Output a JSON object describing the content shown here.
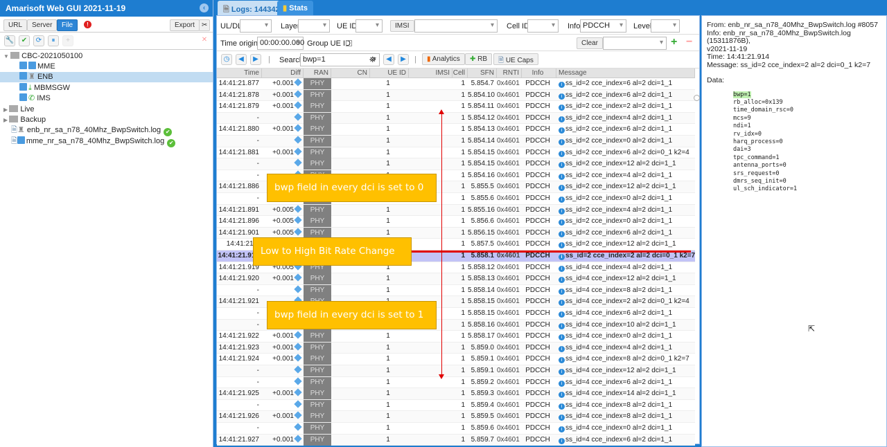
{
  "app": {
    "title": "Amarisoft Web GUI 2021-11-19"
  },
  "left": {
    "buttons": {
      "url": "URL",
      "server": "Server",
      "file": "File",
      "export": "Export"
    },
    "tree": [
      {
        "label": "CBC-2021050100",
        "type": "folder",
        "expanded": true
      },
      {
        "label": "MME",
        "type": "node"
      },
      {
        "label": "ENB",
        "type": "node",
        "selected": true
      },
      {
        "label": "MBMSGW",
        "type": "node"
      },
      {
        "label": "IMS",
        "type": "node"
      },
      {
        "label": "Live",
        "type": "folder"
      },
      {
        "label": "Backup",
        "type": "folder"
      },
      {
        "label": "enb_nr_sa_n78_40Mhz_BwpSwitch.log",
        "type": "log",
        "status": "ok"
      },
      {
        "label": "mme_nr_sa_n78_40Mhz_BwpSwitch.log",
        "type": "log",
        "status": "ok"
      }
    ]
  },
  "tabs": [
    {
      "label": "Logs: 144342",
      "active": true
    },
    {
      "label": "Stats"
    }
  ],
  "filters": {
    "uldl_label": "UL/DL",
    "layer_label": "Layer",
    "ueid_label": "UE ID",
    "imsi_label": "IMSI",
    "cellid_label": "Cell ID",
    "info_label": "Info",
    "info_value": "PDCCH",
    "level_label": "Level",
    "time_origin_label": "Time origin:",
    "time_origin_value": "00:00:00.000",
    "group_ueid_label": "Group UE ID:",
    "clear": "Clear"
  },
  "toolbar": {
    "search_label": "Search",
    "search_value": "bwp=1",
    "analytics": "Analytics",
    "rb": "RB",
    "uecaps": "UE Caps"
  },
  "table": {
    "columns": [
      "Time",
      "Diff",
      "RAN",
      "CN",
      "UE ID",
      "IMSI",
      "Cell",
      "SFN",
      "RNTI",
      "Info",
      "Message"
    ],
    "rows": [
      [
        "14:41:21.877",
        "+0.001",
        "PHY",
        "",
        "1",
        "",
        "1",
        "5.854.7",
        "0x4601",
        "PDCCH",
        "ss_id=2 cce_index=6 al=2 dci=1_1"
      ],
      [
        "14:41:21.878",
        "+0.001",
        "PHY",
        "",
        "1",
        "",
        "1",
        "5.854.10",
        "0x4601",
        "PDCCH",
        "ss_id=2 cce_index=6 al=2 dci=1_1"
      ],
      [
        "14:41:21.879",
        "+0.001",
        "PHY",
        "",
        "1",
        "",
        "1",
        "5.854.11",
        "0x4601",
        "PDCCH",
        "ss_id=2 cce_index=2 al=2 dci=1_1"
      ],
      [
        "-",
        "",
        "PHY",
        "",
        "1",
        "",
        "1",
        "5.854.12",
        "0x4601",
        "PDCCH",
        "ss_id=2 cce_index=4 al=2 dci=1_1"
      ],
      [
        "14:41:21.880",
        "+0.001",
        "PHY",
        "",
        "1",
        "",
        "1",
        "5.854.13",
        "0x4601",
        "PDCCH",
        "ss_id=2 cce_index=6 al=2 dci=1_1"
      ],
      [
        "-",
        "",
        "PHY",
        "",
        "1",
        "",
        "1",
        "5.854.14",
        "0x4601",
        "PDCCH",
        "ss_id=2 cce_index=0 al=2 dci=1_1"
      ],
      [
        "14:41:21.881",
        "+0.001",
        "PHY",
        "",
        "1",
        "",
        "1",
        "5.854.15",
        "0x4601",
        "PDCCH",
        "ss_id=2 cce_index=6 al=2 dci=0_1 k2=4"
      ],
      [
        "-",
        "",
        "PHY",
        "",
        "1",
        "",
        "1",
        "5.854.15",
        "0x4601",
        "PDCCH",
        "ss_id=2 cce_index=12 al=2 dci=1_1"
      ],
      [
        "-",
        "",
        "PHY",
        "",
        "1",
        "",
        "1",
        "5.854.16",
        "0x4601",
        "PDCCH",
        "ss_id=2 cce_index=4 al=2 dci=1_1"
      ],
      [
        "14:41:21.886",
        "",
        "PHY",
        "",
        "1",
        "",
        "1",
        "5.855.5",
        "0x4601",
        "PDCCH",
        "ss_id=2 cce_index=12 al=2 dci=1_1"
      ],
      [
        "-",
        "",
        "PHY",
        "",
        "1",
        "",
        "1",
        "5.855.6",
        "0x4601",
        "PDCCH",
        "ss_id=2 cce_index=0 al=2 dci=1_1"
      ],
      [
        "14:41:21.891",
        "+0.005",
        "PHY",
        "",
        "1",
        "",
        "1",
        "5.855.16",
        "0x4601",
        "PDCCH",
        "ss_id=2 cce_index=4 al=2 dci=1_1"
      ],
      [
        "14:41:21.896",
        "+0.005",
        "PHY",
        "",
        "1",
        "",
        "1",
        "5.856.6",
        "0x4601",
        "PDCCH",
        "ss_id=2 cce_index=0 al=2 dci=1_1"
      ],
      [
        "14:41:21.901",
        "+0.005",
        "PHY",
        "",
        "1",
        "",
        "1",
        "5.856.15",
        "0x4601",
        "PDCCH",
        "ss_id=2 cce_index=6 al=2 dci=1_1"
      ],
      [
        "14:41:21.9",
        "",
        "PHY",
        "",
        "1",
        "",
        "1",
        "5.857.5",
        "0x4601",
        "PDCCH",
        "ss_id=2 cce_index=12 al=2 dci=1_1"
      ],
      [
        "14:41:21.914",
        "",
        "PHY",
        "",
        "1",
        "",
        "1",
        "5.858.1",
        "0x4601",
        "PDCCH",
        "ss_id=2 cce_index=2 al=2 dci=0_1 k2=7"
      ],
      [
        "14:41:21.919",
        "+0.005",
        "PHY",
        "",
        "1",
        "",
        "1",
        "5.858.12",
        "0x4601",
        "PDCCH",
        "ss_id=4 cce_index=4 al=2 dci=1_1"
      ],
      [
        "14:41:21.920",
        "+0.001",
        "PHY",
        "",
        "1",
        "",
        "1",
        "5.858.13",
        "0x4601",
        "PDCCH",
        "ss_id=4 cce_index=12 al=2 dci=1_1"
      ],
      [
        "-",
        "",
        "PHY",
        "",
        "1",
        "",
        "1",
        "5.858.14",
        "0x4601",
        "PDCCH",
        "ss_id=4 cce_index=8 al=2 dci=1_1"
      ],
      [
        "14:41:21.921",
        "",
        "PHY",
        "",
        "1",
        "",
        "1",
        "5.858.15",
        "0x4601",
        "PDCCH",
        "ss_id=4 cce_index=2 al=2 dci=0_1 k2=4"
      ],
      [
        "-",
        "",
        "PHY",
        "",
        "1",
        "",
        "1",
        "5.858.15",
        "0x4601",
        "PDCCH",
        "ss_id=4 cce_index=6 al=2 dci=1_1"
      ],
      [
        "-",
        "",
        "PHY",
        "",
        "1",
        "",
        "1",
        "5.858.16",
        "0x4601",
        "PDCCH",
        "ss_id=4 cce_index=10 al=2 dci=1_1"
      ],
      [
        "14:41:21.922",
        "+0.001",
        "PHY",
        "",
        "1",
        "",
        "1",
        "5.858.17",
        "0x4601",
        "PDCCH",
        "ss_id=4 cce_index=0 al=2 dci=1_1"
      ],
      [
        "14:41:21.923",
        "+0.001",
        "PHY",
        "",
        "1",
        "",
        "1",
        "5.859.0",
        "0x4601",
        "PDCCH",
        "ss_id=4 cce_index=4 al=2 dci=1_1"
      ],
      [
        "14:41:21.924",
        "+0.001",
        "PHY",
        "",
        "1",
        "",
        "1",
        "5.859.1",
        "0x4601",
        "PDCCH",
        "ss_id=4 cce_index=8 al=2 dci=0_1 k2=7"
      ],
      [
        "-",
        "",
        "PHY",
        "",
        "1",
        "",
        "1",
        "5.859.1",
        "0x4601",
        "PDCCH",
        "ss_id=4 cce_index=12 al=2 dci=1_1"
      ],
      [
        "-",
        "",
        "PHY",
        "",
        "1",
        "",
        "1",
        "5.859.2",
        "0x4601",
        "PDCCH",
        "ss_id=4 cce_index=6 al=2 dci=1_1"
      ],
      [
        "14:41:21.925",
        "+0.001",
        "PHY",
        "",
        "1",
        "",
        "1",
        "5.859.3",
        "0x4601",
        "PDCCH",
        "ss_id=4 cce_index=14 al=2 dci=1_1"
      ],
      [
        "-",
        "",
        "PHY",
        "",
        "1",
        "",
        "1",
        "5.859.4",
        "0x4601",
        "PDCCH",
        "ss_id=4 cce_index=8 al=2 dci=1_1"
      ],
      [
        "14:41:21.926",
        "+0.001",
        "PHY",
        "",
        "1",
        "",
        "1",
        "5.859.5",
        "0x4601",
        "PDCCH",
        "ss_id=4 cce_index=8 al=2 dci=1_1"
      ],
      [
        "-",
        "",
        "PHY",
        "",
        "1",
        "",
        "1",
        "5.859.6",
        "0x4601",
        "PDCCH",
        "ss_id=4 cce_index=0 al=2 dci=1_1"
      ],
      [
        "14:41:21.927",
        "+0.001",
        "PHY",
        "",
        "1",
        "",
        "1",
        "5.859.7",
        "0x4601",
        "PDCCH",
        "ss_id=4 cce_index=6 al=2 dci=1_1"
      ]
    ],
    "selected_row": 15
  },
  "detail": {
    "from": "From: enb_nr_sa_n78_40Mhz_BwpSwitch.log #8057",
    "info": "Info: enb_nr_sa_n78_40Mhz_BwpSwitch.log (15311876B),",
    "version": "v2021-11-19",
    "time": "Time: 14:41:21.914",
    "message": "Message: ss_id=2 cce_index=2 al=2 dci=0_1 k2=7",
    "data_label": "Data:",
    "data": [
      "bwp=1",
      "rb_alloc=0x139",
      "time_domain_rsc=0",
      "mcs=9",
      "ndi=1",
      "rv_idx=0",
      "harq_process=0",
      "dai=3",
      "tpc_command=1",
      "antenna_ports=0",
      "srs_request=0",
      "dmrs_seq_init=0",
      "ul_sch_indicator=1"
    ]
  },
  "annotations": {
    "top": "bwp field in every dci is set to 0",
    "middle": "Low to High Bit Rate Change",
    "bottom": "bwp field in every dci is set to 1"
  },
  "colors": {
    "accent": "#1e7dd0",
    "selected_row": "#c2c3f7",
    "callout": "#ffc000",
    "annotation_line": "#e00000"
  }
}
